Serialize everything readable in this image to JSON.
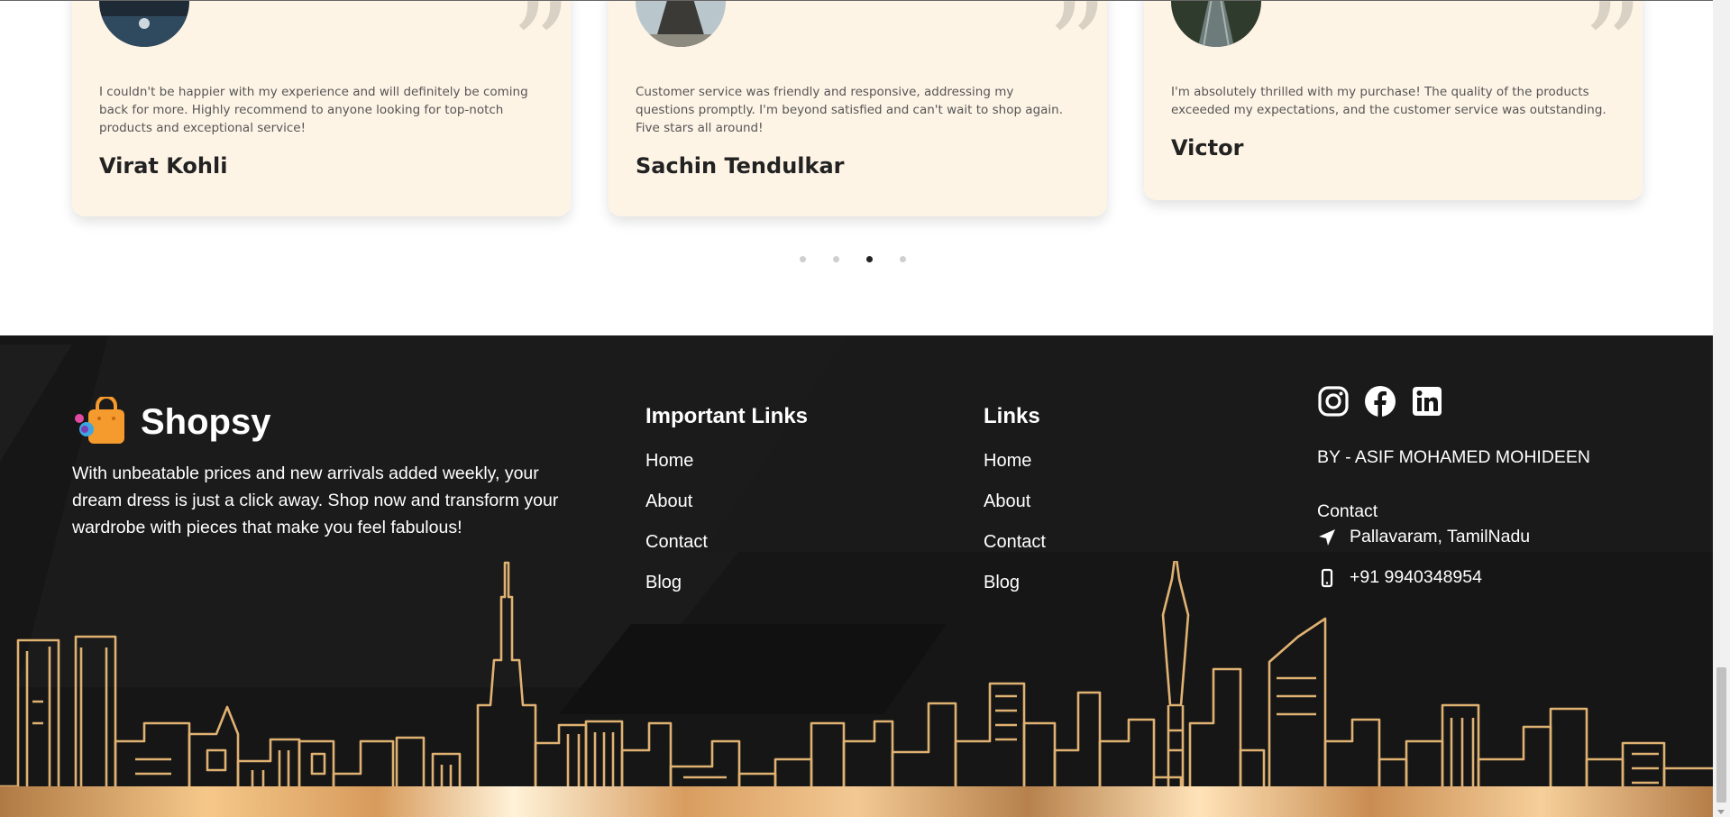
{
  "testimonials": [
    {
      "text": "I couldn't be happier with my experience and will definitely be coming back for more. Highly recommend to anyone looking for top-notch products and exceptional service!",
      "name": "Virat Kohli"
    },
    {
      "text": "Customer service was friendly and responsive, addressing my questions promptly. I'm beyond satisfied and can't wait to shop again. Five stars all around!",
      "name": "Sachin Tendulkar"
    },
    {
      "text": "I'm absolutely thrilled with my purchase! The quality of the products exceeded my expectations, and the customer service was outstanding.",
      "name": "Victor"
    }
  ],
  "carousel": {
    "dot_count": 4,
    "active_index": 2
  },
  "footer": {
    "brand": "Shopsy",
    "description": "With unbeatable prices and new arrivals added weekly, your dream dress is just a click away. Shop now and transform your wardrobe with pieces that make you feel fabulous!",
    "important_links": {
      "title": "Important Links",
      "items": [
        "Home",
        "About",
        "Contact",
        "Blog"
      ]
    },
    "links": {
      "title": "Links",
      "items": [
        "Home",
        "About",
        "Contact",
        "Blog"
      ]
    },
    "social_icons": [
      "instagram-icon",
      "facebook-icon",
      "linkedin-icon"
    ],
    "byline": "BY - ASIF MOHAMED MOHIDEEN",
    "contact": {
      "heading": "Contact",
      "location": "Pallavaram, TamilNadu",
      "phone": "+91 9940348954"
    }
  },
  "colors": {
    "card_bg": "#fef4e6",
    "footer_bg": "#161616",
    "skyline_gold": "#e0b272",
    "brand_orange": "#f59a2c"
  }
}
